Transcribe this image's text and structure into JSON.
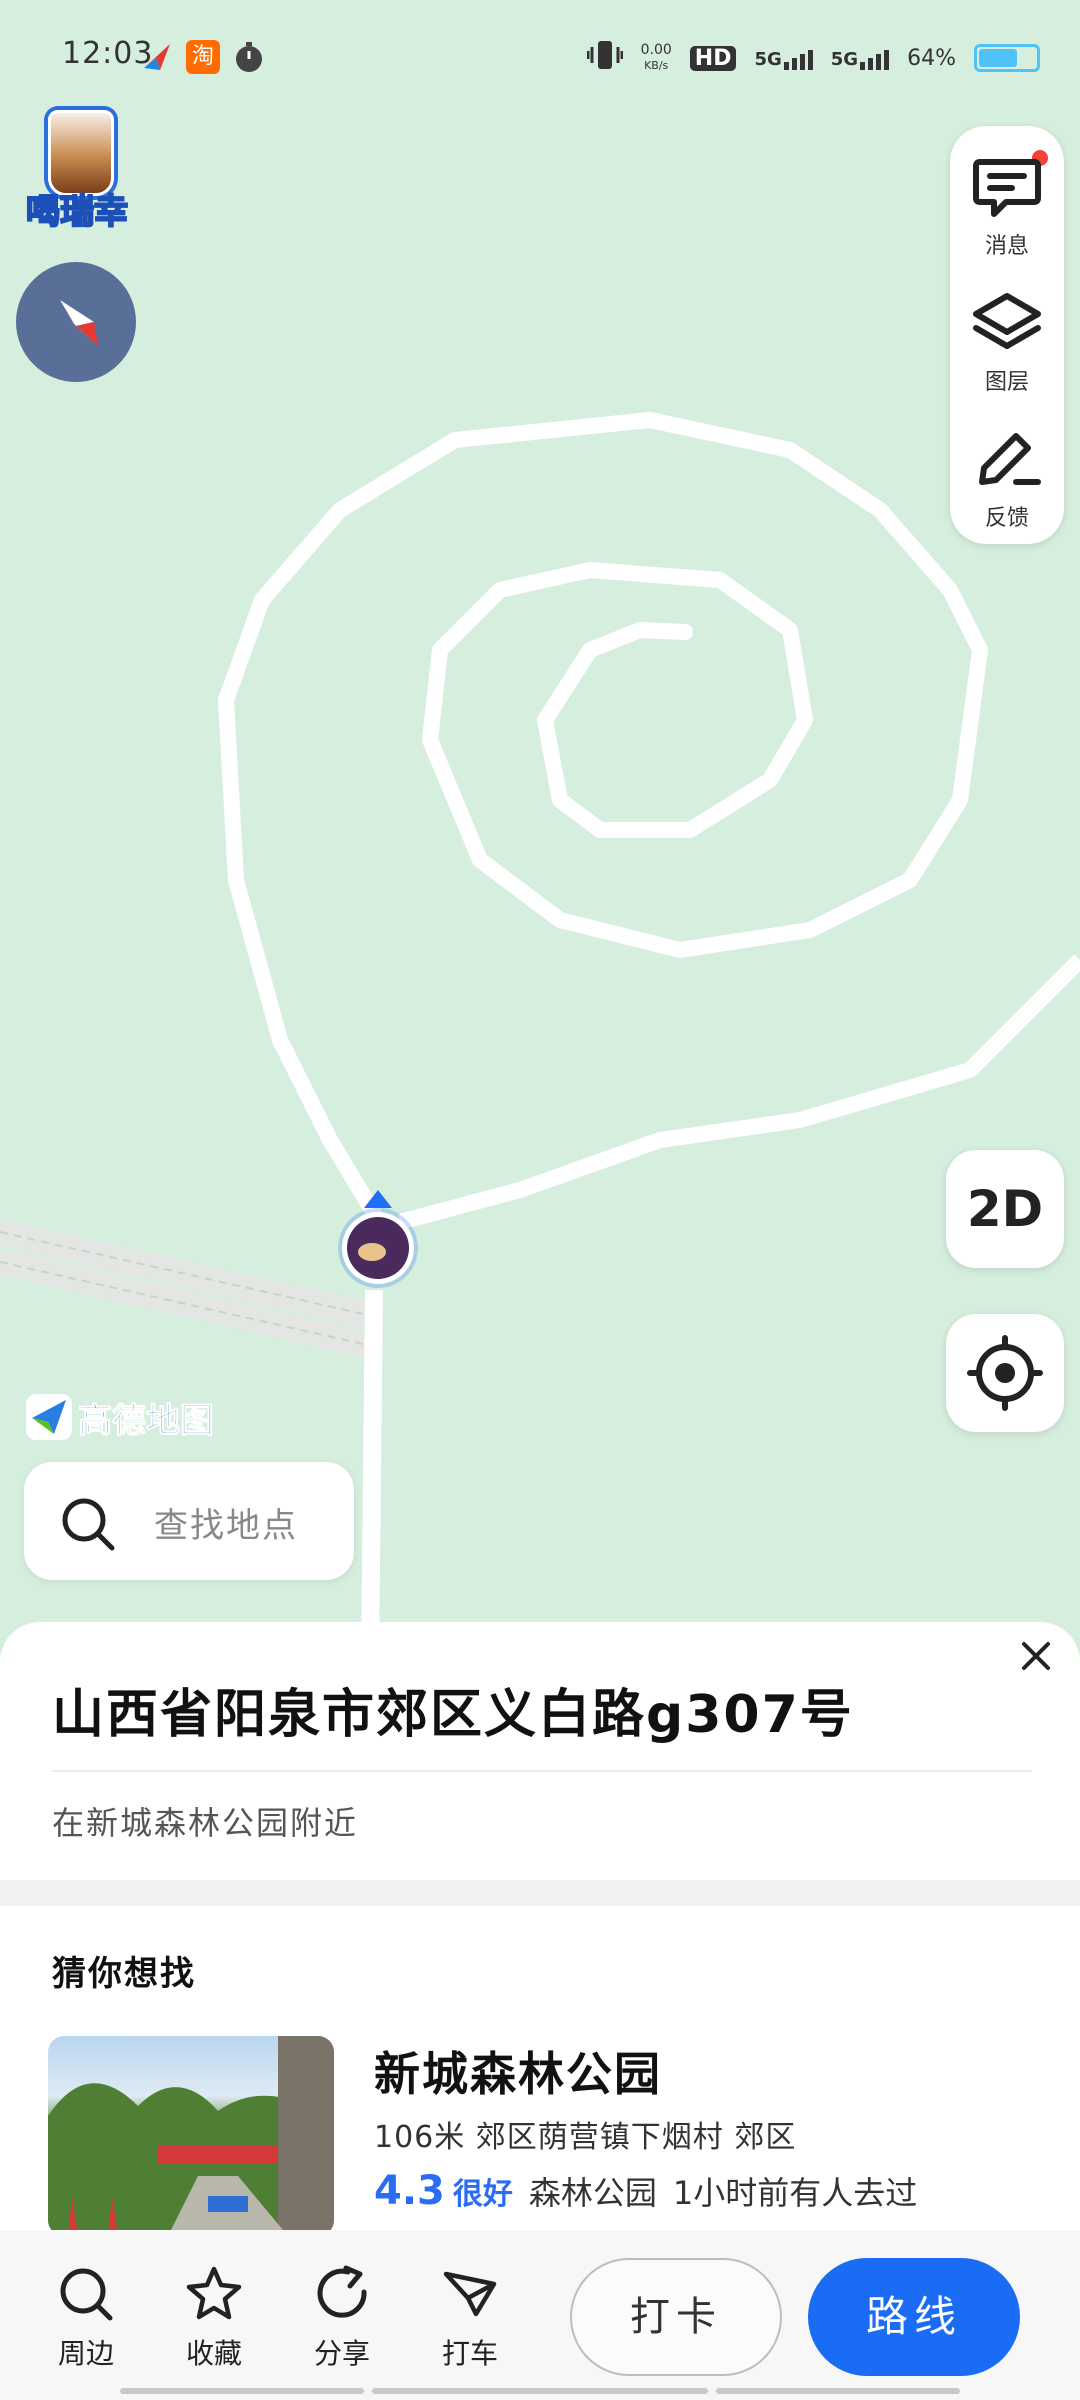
{
  "status_bar": {
    "time": "12:03",
    "net_speed_value": "0.00",
    "net_speed_unit": "KB/s",
    "hd_label": "HD",
    "signal_1": "5G",
    "signal_2": "5G",
    "battery": "64%"
  },
  "promo": {
    "label": "喝瑞幸"
  },
  "map_controls": {
    "messages_label": "消息",
    "layers_label": "图层",
    "feedback_label": "反馈",
    "view_mode": "2D",
    "brand": "高德地图"
  },
  "search": {
    "placeholder": "查找地点"
  },
  "place": {
    "address": "山西省阳泉市郊区义白路g307号",
    "nearby": "在新城森林公园附近"
  },
  "suggestions": {
    "title": "猜你想找",
    "items": [
      {
        "name": "新城森林公园",
        "detail": "106米 郊区荫营镇下烟村 郊区",
        "score": "4.3",
        "score_word": "很好",
        "category": "森林公园",
        "visit_note": "1小时前有人去过"
      }
    ]
  },
  "actions": {
    "nearby": "周边",
    "favorite": "收藏",
    "share": "分享",
    "taxi": "打车",
    "checkin": "打卡",
    "route": "路线"
  },
  "colors": {
    "accent": "#1a6cf5",
    "map_bg": "#d6eedd",
    "badge_red": "#f44336"
  }
}
